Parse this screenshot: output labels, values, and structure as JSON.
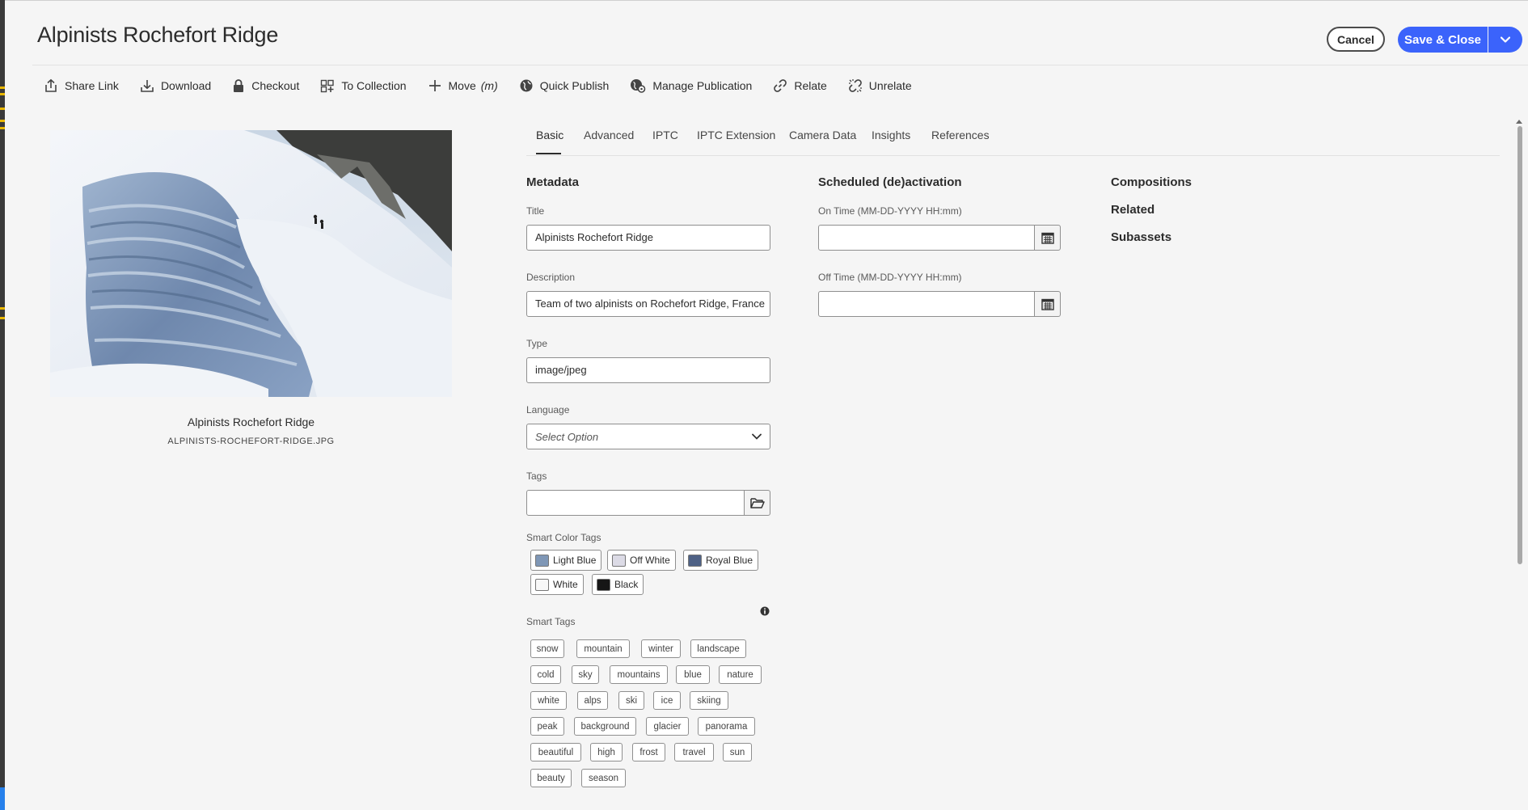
{
  "page": {
    "title": "Alpinists Rochefort Ridge",
    "cancel_label": "Cancel",
    "save_label": "Save & Close"
  },
  "toolbar": [
    {
      "label": "Share Link",
      "icon": "share-icon"
    },
    {
      "label": "Download",
      "icon": "download-icon"
    },
    {
      "label": "Checkout",
      "icon": "lock-icon"
    },
    {
      "label": "To Collection",
      "icon": "collection-icon"
    },
    {
      "label": "Move",
      "shortcut": "(m)",
      "icon": "move-icon"
    },
    {
      "label": "Quick Publish",
      "icon": "globe-icon"
    },
    {
      "label": "Manage Publication",
      "icon": "globe-gear-icon"
    },
    {
      "label": "Relate",
      "icon": "link-icon"
    },
    {
      "label": "Unrelate",
      "icon": "unlink-icon"
    }
  ],
  "asset": {
    "name": "Alpinists Rochefort Ridge",
    "filename": "ALPINISTS-ROCHEFORT-RIDGE.JPG"
  },
  "tabs": [
    "Basic",
    "Advanced",
    "IPTC",
    "IPTC Extension",
    "Camera Data",
    "Insights",
    "References"
  ],
  "active_tab": "Basic",
  "metadata": {
    "section_title": "Metadata",
    "title_label": "Title",
    "title_value": "Alpinists Rochefort Ridge",
    "description_label": "Description",
    "description_value": "Team of two alpinists on Rochefort Ridge, France",
    "type_label": "Type",
    "type_value": "image/jpeg",
    "language_label": "Language",
    "language_placeholder": "Select Option",
    "tags_label": "Tags",
    "tags_value": "",
    "smart_color_tags_label": "Smart Color Tags",
    "smart_color_tags": [
      {
        "label": "Light Blue",
        "color": "#7f97b6"
      },
      {
        "label": "Off White",
        "color": "#dcdbe6"
      },
      {
        "label": "Royal Blue",
        "color": "#4e6185"
      },
      {
        "label": "White",
        "color": "#f8f8f8"
      },
      {
        "label": "Black",
        "color": "#161616"
      }
    ],
    "smart_tags_label": "Smart Tags",
    "smart_tags": [
      "snow",
      "mountain",
      "winter",
      "landscape",
      "cold",
      "sky",
      "mountains",
      "blue",
      "nature",
      "white",
      "alps",
      "ski",
      "ice",
      "skiing",
      "peak",
      "background",
      "glacier",
      "panorama",
      "beautiful",
      "high",
      "frost",
      "travel",
      "sun",
      "beauty",
      "season"
    ]
  },
  "scheduled": {
    "section_title": "Scheduled (de)activation",
    "on_time_label": "On Time (MM-DD-YYYY HH:mm)",
    "on_time_value": "",
    "off_time_label": "Off Time (MM-DD-YYYY HH:mm)",
    "off_time_value": ""
  },
  "related_links": [
    "Compositions",
    "Related",
    "Subassets"
  ],
  "colors": {
    "accent": "#3b63fb"
  }
}
